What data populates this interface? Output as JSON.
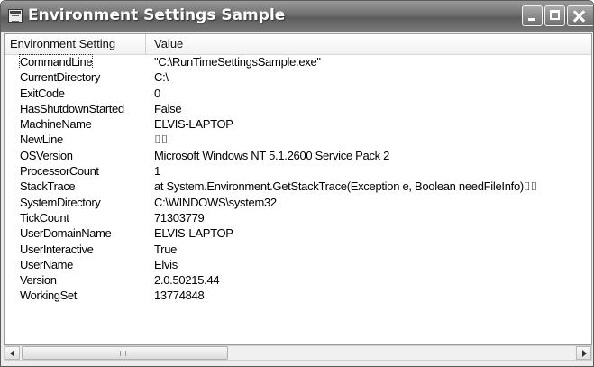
{
  "window": {
    "title": "Environment Settings Sample",
    "icons": {
      "app": "app-window-icon",
      "minimize": "minimize-icon",
      "maximize": "maximize-icon",
      "close": "close-icon"
    }
  },
  "listview": {
    "columns": [
      "Environment Setting",
      "Value"
    ],
    "rows": [
      {
        "name": "CommandLine",
        "value": "\"C:\\RunTimeSettingsSample.exe\""
      },
      {
        "name": "CurrentDirectory",
        "value": "C:\\"
      },
      {
        "name": "ExitCode",
        "value": "0"
      },
      {
        "name": "HasShutdownStarted",
        "value": "False"
      },
      {
        "name": "MachineName",
        "value": "ELVIS-LAPTOP"
      },
      {
        "name": "NewLine",
        "value": "⌷⌷"
      },
      {
        "name": "OSVersion",
        "value": "Microsoft Windows NT 5.1.2600 Service Pack 2"
      },
      {
        "name": "ProcessorCount",
        "value": "1"
      },
      {
        "name": "StackTrace",
        "value": "   at System.Environment.GetStackTrace(Exception e, Boolean needFileInfo)⌷⌷"
      },
      {
        "name": "SystemDirectory",
        "value": "C:\\WINDOWS\\system32"
      },
      {
        "name": "TickCount",
        "value": "71303779"
      },
      {
        "name": "UserDomainName",
        "value": "ELVIS-LAPTOP"
      },
      {
        "name": "UserInteractive",
        "value": "True"
      },
      {
        "name": "UserName",
        "value": "Elvis"
      },
      {
        "name": "Version",
        "value": "2.0.50215.44"
      },
      {
        "name": "WorkingSet",
        "value": "13774848"
      }
    ]
  },
  "scrollbar": {
    "left_icon": "scroll-left-icon",
    "right_icon": "scroll-right-icon"
  }
}
